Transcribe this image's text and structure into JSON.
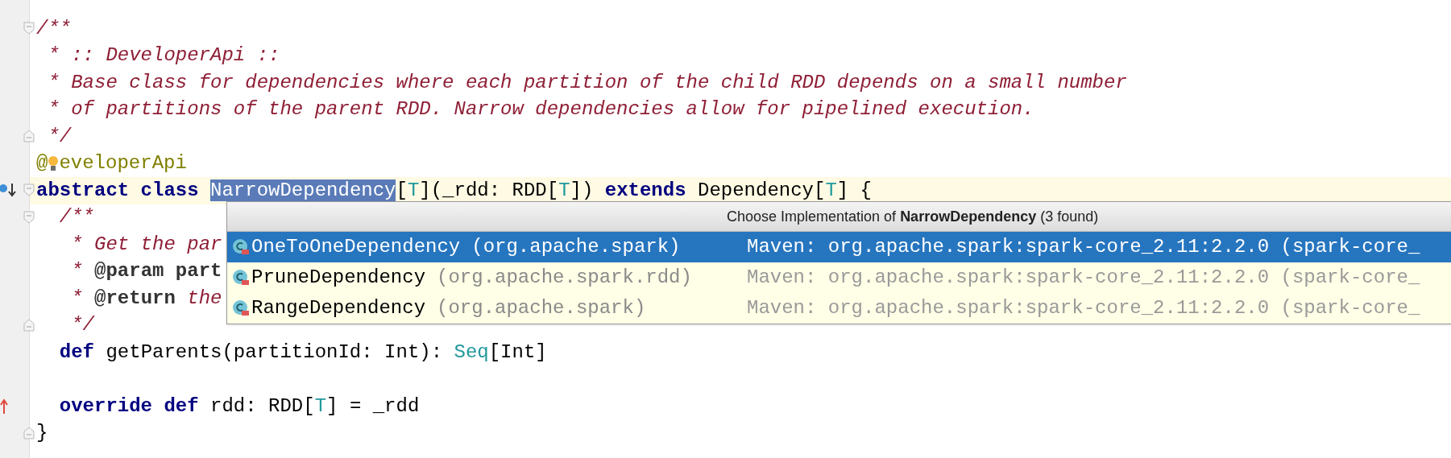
{
  "editor": {
    "lines": [
      {
        "fold_start": true,
        "tokens": [
          {
            "kind": "comment",
            "text": "/**"
          }
        ]
      },
      {
        "tokens": [
          {
            "kind": "comment",
            "text": " * :: DeveloperApi ::"
          }
        ]
      },
      {
        "tokens": [
          {
            "kind": "comment",
            "text": " * Base class for dependencies where each partition of the child RDD depends on a small number"
          }
        ]
      },
      {
        "tokens": [
          {
            "kind": "comment",
            "text": " * of partitions of the parent RDD. Narrow dependencies allow for pipelined execution."
          }
        ]
      },
      {
        "fold_end": true,
        "tokens": [
          {
            "kind": "comment",
            "text": " */"
          }
        ]
      },
      {
        "intention_bulb": true,
        "tokens": [
          {
            "kind": "annotation",
            "text": "@"
          },
          {
            "kind": "annotation",
            "text": "eveloperApi"
          }
        ]
      },
      {
        "fold_start": true,
        "current": true,
        "implemented_marker": true,
        "tokens": [
          {
            "kind": "keyword",
            "text": "abstract class "
          },
          {
            "kind": "selection",
            "text": "NarrowDependency"
          },
          {
            "kind": "plain",
            "text": "["
          },
          {
            "kind": "type_param",
            "text": "T"
          },
          {
            "kind": "plain",
            "text": "](_rdd: RDD["
          },
          {
            "kind": "type_param",
            "text": "T"
          },
          {
            "kind": "plain",
            "text": "]) "
          },
          {
            "kind": "keyword",
            "text": "extends"
          },
          {
            "kind": "plain",
            "text": " Dependency["
          },
          {
            "kind": "type_param",
            "text": "T"
          },
          {
            "kind": "plain",
            "text": "] {"
          }
        ]
      },
      {
        "fold_start": true,
        "tokens": [
          {
            "kind": "comment",
            "text": "  /**"
          }
        ]
      },
      {
        "tokens": [
          {
            "kind": "comment",
            "text": "   * Get the par"
          }
        ]
      },
      {
        "tokens": [
          {
            "kind": "comment",
            "text": "   * "
          },
          {
            "kind": "doc_tag",
            "text": "@param part"
          }
        ]
      },
      {
        "tokens": [
          {
            "kind": "comment",
            "text": "   * "
          },
          {
            "kind": "doc_tag",
            "text": "@return"
          },
          {
            "kind": "comment",
            "text": " the"
          }
        ]
      },
      {
        "fold_end": true,
        "tokens": [
          {
            "kind": "comment",
            "text": "   */"
          }
        ]
      },
      {
        "tokens": [
          {
            "kind": "keyword",
            "text": "  def"
          },
          {
            "kind": "plain",
            "text": " getParents(partitionId: Int): "
          },
          {
            "kind": "predefined",
            "text": "Seq"
          },
          {
            "kind": "plain",
            "text": "[Int]"
          }
        ]
      },
      {
        "blank_line_before": true,
        "overrides_marker": true,
        "tokens": [
          {
            "kind": "keyword",
            "text": "  override def"
          },
          {
            "kind": "plain",
            "text": " rdd: RDD["
          },
          {
            "kind": "type_param",
            "text": "T"
          },
          {
            "kind": "plain",
            "text": "] = _rdd"
          }
        ]
      },
      {
        "fold_end": true,
        "tokens": [
          {
            "kind": "plain",
            "text": "}"
          }
        ]
      }
    ]
  },
  "popup": {
    "title": "Choose Implementation of **NarrowDependency** (3 found)",
    "items": [
      {
        "name": "OneToOneDependency",
        "package": "(org.apache.spark)",
        "location": "Maven: org.apache.spark:spark-core_2.11:2.2.0 (spark-core_",
        "selected": true
      },
      {
        "name": "PruneDependency",
        "package": "(org.apache.spark.rdd)",
        "location": "Maven: org.apache.spark:spark-core_2.11:2.2.0 (spark-core_",
        "selected": false
      },
      {
        "name": "RangeDependency",
        "package": "(org.apache.spark)",
        "location": "Maven: org.apache.spark:spark-core_2.11:2.2.0 (spark-core_",
        "selected": false
      }
    ]
  }
}
